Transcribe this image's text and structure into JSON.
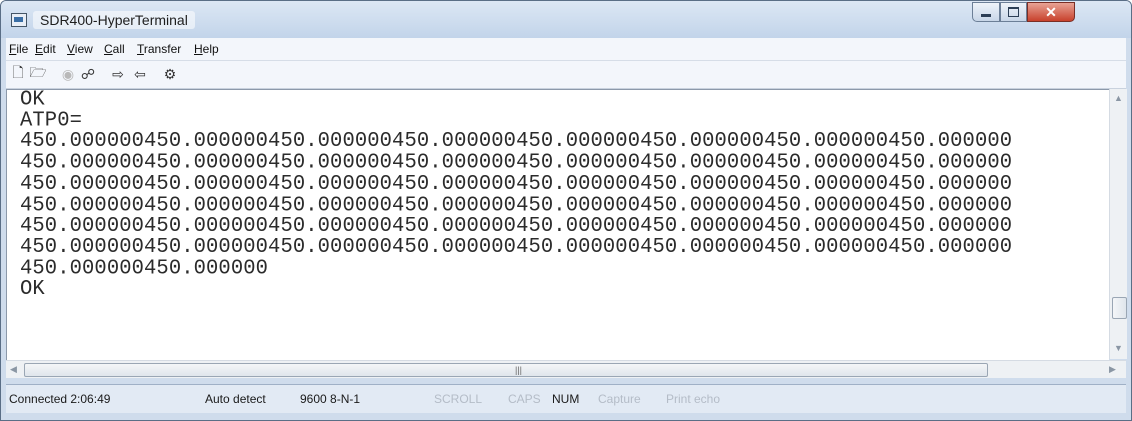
{
  "window": {
    "title": "SDR400-HyperTerminal"
  },
  "menu": {
    "items": [
      {
        "accel": "F",
        "rest": "ile"
      },
      {
        "accel": "E",
        "rest": "dit"
      },
      {
        "accel": "V",
        "rest": "iew"
      },
      {
        "accel": "C",
        "rest": "all"
      },
      {
        "accel": "T",
        "rest": "ransfer"
      },
      {
        "accel": "H",
        "rest": "elp"
      }
    ]
  },
  "toolbar": {
    "icons": [
      "new-icon",
      "open-icon",
      "connect-icon",
      "disconnect-icon",
      "send-icon",
      "receive-icon",
      "properties-icon"
    ]
  },
  "terminal": {
    "lines": [
      "OK",
      "ATP0=",
      "450.000000450.000000450.000000450.000000450.000000450.000000450.000000450.000000",
      "450.000000450.000000450.000000450.000000450.000000450.000000450.000000450.000000",
      "450.000000450.000000450.000000450.000000450.000000450.000000450.000000450.000000",
      "450.000000450.000000450.000000450.000000450.000000450.000000450.000000450.000000",
      "450.000000450.000000450.000000450.000000450.000000450.000000450.000000450.000000",
      "450.000000450.000000450.000000450.000000450.000000450.000000450.000000450.000000",
      "450.000000450.000000",
      "OK"
    ]
  },
  "status": {
    "connected": "Connected 2:06:49",
    "detect": "Auto detect",
    "port": "9600 8-N-1",
    "scroll": "SCROLL",
    "caps": "CAPS",
    "num": "NUM",
    "capture": "Capture",
    "print_echo": "Print echo"
  }
}
